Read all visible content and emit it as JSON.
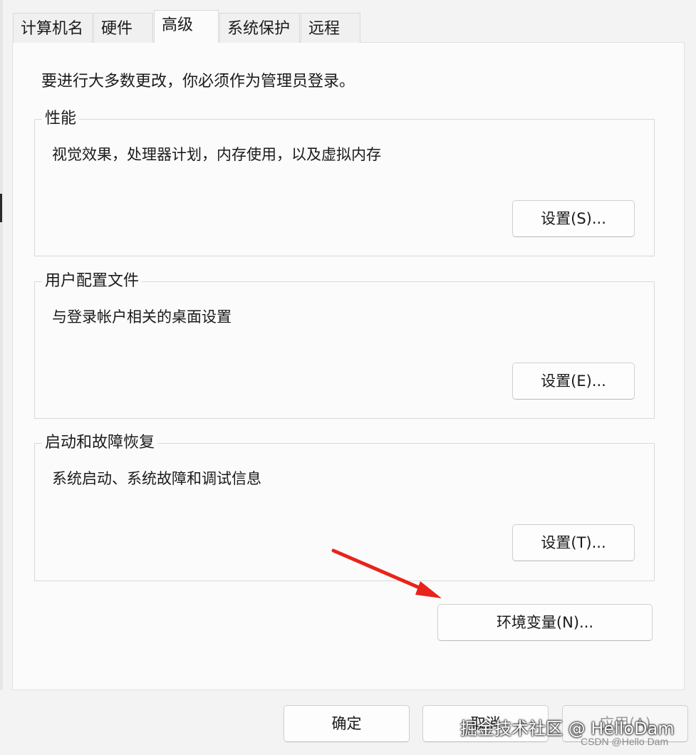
{
  "tabs": [
    "计算机名",
    "硬件",
    "高级",
    "系统保护",
    "远程"
  ],
  "active_tab": "高级",
  "intro": "要进行大多数更改，你必须作为管理员登录。",
  "groups": {
    "performance": {
      "title": "性能",
      "desc": "视觉效果，处理器计划，内存使用，以及虚拟内存",
      "button": "设置(S)..."
    },
    "profiles": {
      "title": "用户配置文件",
      "desc": "与登录帐户相关的桌面设置",
      "button": "设置(E)..."
    },
    "startup": {
      "title": "启动和故障恢复",
      "desc": "系统启动、系统故障和调试信息",
      "button": "设置(T)..."
    }
  },
  "env_button": "环境变量(N)...",
  "footer": {
    "ok": "确定",
    "cancel": "取消",
    "apply": "应用(A)"
  },
  "watermark": "掘金技术社区 @ HelloDam",
  "csdn_mark": "CSDN @Hello Dam",
  "annotation_color": "#e8231b"
}
